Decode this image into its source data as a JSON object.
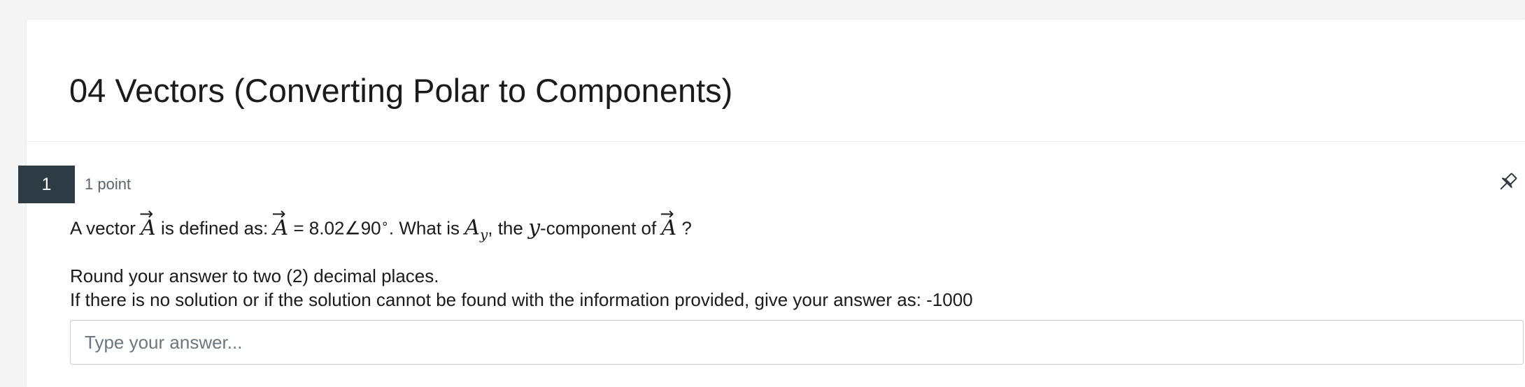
{
  "page": {
    "title": "04 Vectors (Converting Polar to Components)"
  },
  "question": {
    "number": "1",
    "points": "1 point",
    "text": {
      "part1": "A vector ",
      "vec_symbol": "A",
      "vec_arrow": "→",
      "part2": " is defined as: ",
      "part3": " = 8.02∠90",
      "degree": "∘",
      "part4": ". What is ",
      "component_base": "A",
      "component_sub": "y",
      "part5": ", the ",
      "y_var": "y",
      "part6": "-component of ",
      "part7": " ?"
    },
    "instructions": {
      "line1": "Round your answer to two (2) decimal places.",
      "line2": "If there is no solution or if the solution cannot be found with the information provided, give your answer as: -1000"
    },
    "answer": {
      "value": "",
      "placeholder": "Type your answer..."
    }
  },
  "icons": {
    "pin": "pin-icon"
  },
  "colors": {
    "question_number_bg": "#2d3b45",
    "text": "#1b1b1b",
    "muted": "#5a646b",
    "input_border": "#c7cdd1"
  }
}
